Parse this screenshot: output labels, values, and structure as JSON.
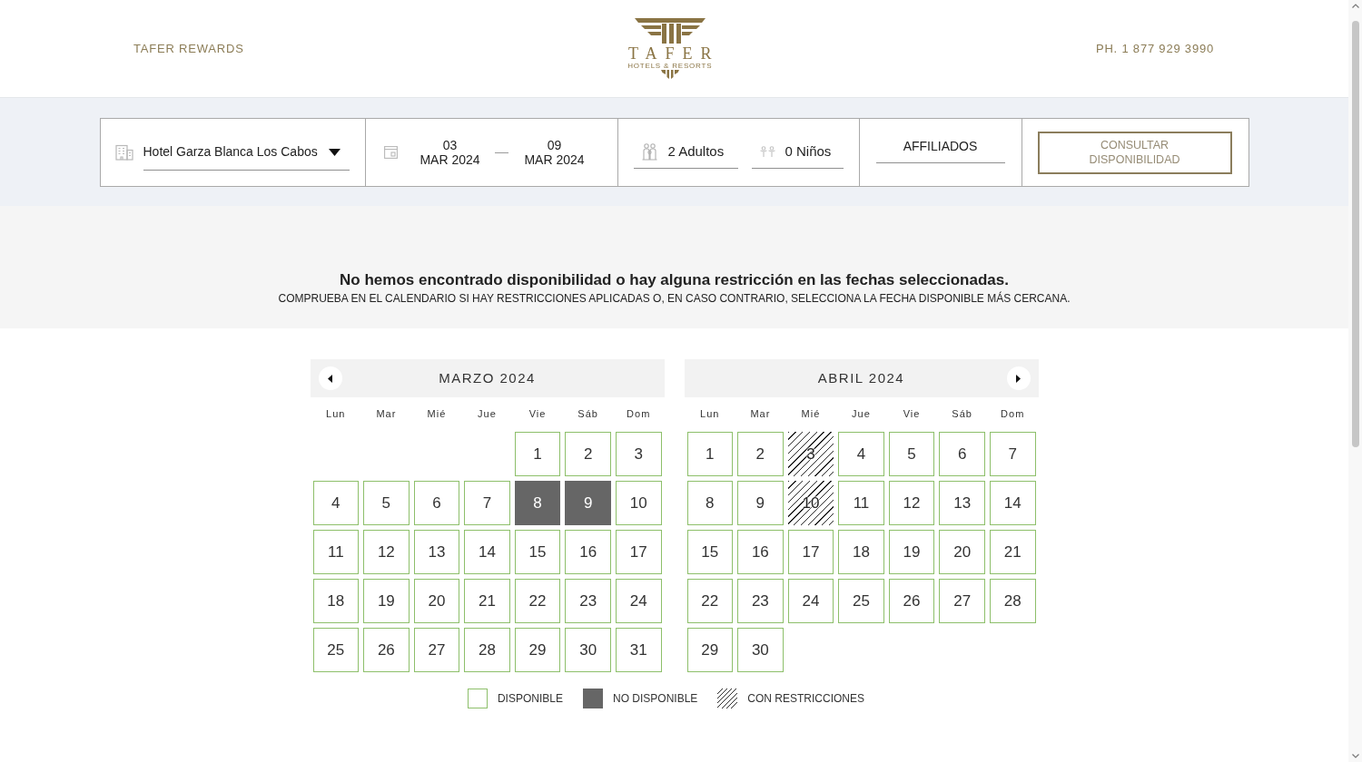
{
  "header": {
    "rewards_link": "TAFER REWARDS",
    "logo": {
      "name": "TAFER",
      "tagline": "HOTELS & RESORTS"
    },
    "phone": "PH. 1 877 929 3990"
  },
  "search_bar": {
    "hotel": {
      "value": "Hotel Garza Blanca Los Cabos"
    },
    "check_in": {
      "day": "03",
      "month_year": "MAR 2024"
    },
    "check_out": {
      "day": "09",
      "month_year": "MAR 2024"
    },
    "adults": {
      "value": "2 Adultos"
    },
    "children": {
      "value": "0 Niños"
    },
    "affiliates": {
      "value": "AFFILIADOS"
    },
    "submit_button": "CONSULTAR DISPONIBILIDAD"
  },
  "notice": {
    "title": "No hemos encontrado disponibilidad o hay alguna restricción en las fechas seleccionadas.",
    "subtitle": "COMPRUEBA EN EL CALENDARIO SI HAY RESTRICCIONES APLICADAS O, EN CASO CONTRARIO, SELECCIONA LA FECHA DISPONIBLE MÁS CERCANA."
  },
  "calendar": {
    "months": [
      {
        "title": "MARZO 2024",
        "previous_button": true,
        "next_button": false,
        "weekdays": [
          "Lun",
          "Mar",
          "Mié",
          "Jue",
          "Vie",
          "Sáb",
          "Dom"
        ],
        "weeks": [
          {
            "kind": "first",
            "days": [
              {
                "day": "1",
                "kind": "available"
              },
              {
                "day": "2",
                "kind": "available"
              },
              {
                "day": "3",
                "kind": "available"
              }
            ]
          },
          {
            "kind": "full",
            "days": [
              {
                "day": "4",
                "kind": "available"
              },
              {
                "day": "5",
                "kind": "available"
              },
              {
                "day": "6",
                "kind": "available"
              },
              {
                "day": "7",
                "kind": "available"
              },
              {
                "day": "8",
                "kind": "unavailable"
              },
              {
                "day": "9",
                "kind": "unavailable"
              },
              {
                "day": "10",
                "kind": "available"
              }
            ]
          },
          {
            "kind": "full",
            "days": [
              {
                "day": "11",
                "kind": "available"
              },
              {
                "day": "12",
                "kind": "available"
              },
              {
                "day": "13",
                "kind": "available"
              },
              {
                "day": "14",
                "kind": "available"
              },
              {
                "day": "15",
                "kind": "available"
              },
              {
                "day": "16",
                "kind": "available"
              },
              {
                "day": "17",
                "kind": "available"
              }
            ]
          },
          {
            "kind": "full",
            "days": [
              {
                "day": "18",
                "kind": "available"
              },
              {
                "day": "19",
                "kind": "available"
              },
              {
                "day": "20",
                "kind": "available"
              },
              {
                "day": "21",
                "kind": "available"
              },
              {
                "day": "22",
                "kind": "available"
              },
              {
                "day": "23",
                "kind": "available"
              },
              {
                "day": "24",
                "kind": "available"
              }
            ]
          },
          {
            "kind": "full",
            "days": [
              {
                "day": "25",
                "kind": "available"
              },
              {
                "day": "26",
                "kind": "available"
              },
              {
                "day": "27",
                "kind": "available"
              },
              {
                "day": "28",
                "kind": "available"
              },
              {
                "day": "29",
                "kind": "available"
              },
              {
                "day": "30",
                "kind": "available"
              },
              {
                "day": "31",
                "kind": "available"
              }
            ]
          }
        ]
      },
      {
        "title": "ABRIL 2024",
        "previous_button": false,
        "next_button": true,
        "weekdays": [
          "Lun",
          "Mar",
          "Mié",
          "Jue",
          "Vie",
          "Sáb",
          "Dom"
        ],
        "weeks": [
          {
            "kind": "full",
            "days": [
              {
                "day": "1",
                "kind": "available"
              },
              {
                "day": "2",
                "kind": "available"
              },
              {
                "day": "3",
                "kind": "restricted"
              },
              {
                "day": "4",
                "kind": "available"
              },
              {
                "day": "5",
                "kind": "available"
              },
              {
                "day": "6",
                "kind": "available"
              },
              {
                "day": "7",
                "kind": "available"
              }
            ]
          },
          {
            "kind": "full",
            "days": [
              {
                "day": "8",
                "kind": "available"
              },
              {
                "day": "9",
                "kind": "available"
              },
              {
                "day": "10",
                "kind": "restricted"
              },
              {
                "day": "11",
                "kind": "available"
              },
              {
                "day": "12",
                "kind": "available"
              },
              {
                "day": "13",
                "kind": "available"
              },
              {
                "day": "14",
                "kind": "available"
              }
            ]
          },
          {
            "kind": "full",
            "days": [
              {
                "day": "15",
                "kind": "available"
              },
              {
                "day": "16",
                "kind": "available"
              },
              {
                "day": "17",
                "kind": "available"
              },
              {
                "day": "18",
                "kind": "available"
              },
              {
                "day": "19",
                "kind": "available"
              },
              {
                "day": "20",
                "kind": "available"
              },
              {
                "day": "21",
                "kind": "available"
              }
            ]
          },
          {
            "kind": "full",
            "days": [
              {
                "day": "22",
                "kind": "available"
              },
              {
                "day": "23",
                "kind": "available"
              },
              {
                "day": "24",
                "kind": "available"
              },
              {
                "day": "25",
                "kind": "available"
              },
              {
                "day": "26",
                "kind": "available"
              },
              {
                "day": "27",
                "kind": "available"
              },
              {
                "day": "28",
                "kind": "available"
              }
            ]
          },
          {
            "kind": "full",
            "days": [
              {
                "day": "29",
                "kind": "available"
              },
              {
                "day": "30",
                "kind": "available"
              }
            ]
          }
        ]
      }
    ]
  },
  "legend": [
    {
      "kind": "available",
      "label": "DISPONIBLE"
    },
    {
      "kind": "unavailable",
      "label": "NO DISPONIBLE"
    },
    {
      "kind": "restricted",
      "label": "CON RESTRICCIONES"
    }
  ]
}
